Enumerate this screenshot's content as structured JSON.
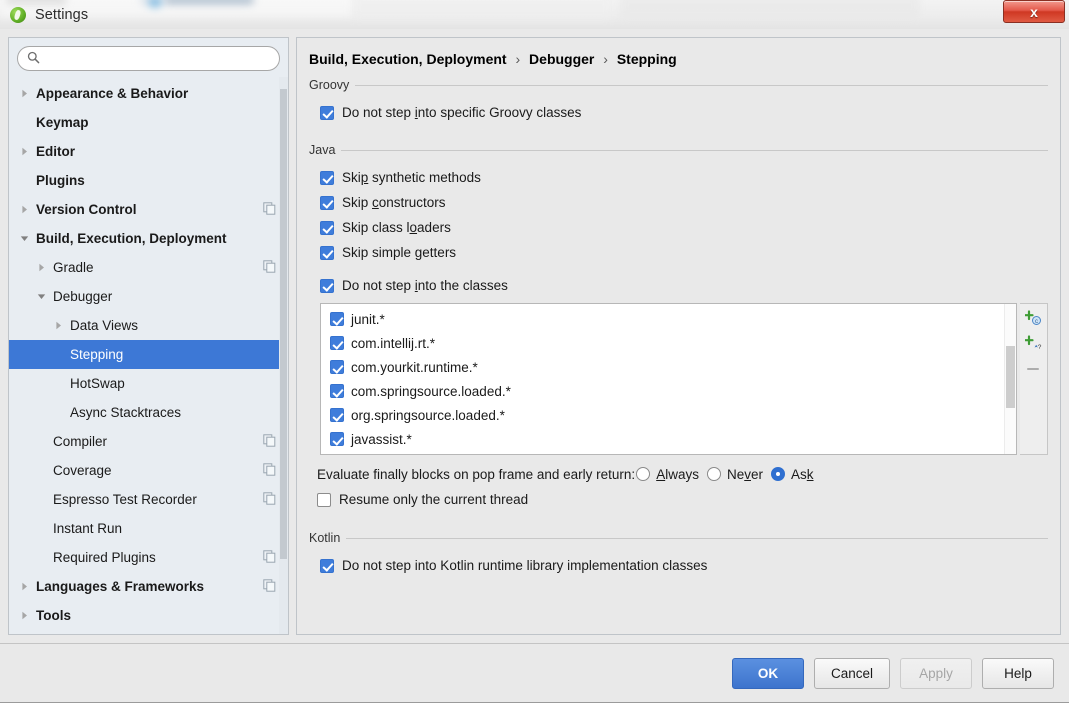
{
  "window": {
    "title": "Settings",
    "app_icon": "intellij-idea-icon",
    "close_label": "x"
  },
  "sidebar": {
    "search": {
      "placeholder": "",
      "value": "",
      "icon": "search-icon"
    },
    "items": [
      {
        "label": "Appearance & Behavior",
        "level": 0,
        "twisty": "collapsed",
        "copy": false,
        "selected": false
      },
      {
        "label": "Keymap",
        "level": 0,
        "twisty": "none",
        "copy": false,
        "selected": false
      },
      {
        "label": "Editor",
        "level": 0,
        "twisty": "collapsed",
        "copy": false,
        "selected": false
      },
      {
        "label": "Plugins",
        "level": 0,
        "twisty": "none",
        "copy": false,
        "selected": false
      },
      {
        "label": "Version Control",
        "level": 0,
        "twisty": "collapsed",
        "copy": true,
        "selected": false
      },
      {
        "label": "Build, Execution, Deployment",
        "level": 0,
        "twisty": "expanded",
        "copy": false,
        "selected": false
      },
      {
        "label": "Gradle",
        "level": 1,
        "twisty": "collapsed",
        "copy": true,
        "selected": false
      },
      {
        "label": "Debugger",
        "level": 1,
        "twisty": "expanded",
        "copy": false,
        "selected": false
      },
      {
        "label": "Data Views",
        "level": 2,
        "twisty": "collapsed",
        "copy": false,
        "selected": false
      },
      {
        "label": "Stepping",
        "level": 2,
        "twisty": "none",
        "copy": false,
        "selected": true
      },
      {
        "label": "HotSwap",
        "level": 2,
        "twisty": "none",
        "copy": false,
        "selected": false
      },
      {
        "label": "Async Stacktraces",
        "level": 2,
        "twisty": "none",
        "copy": false,
        "selected": false
      },
      {
        "label": "Compiler",
        "level": 1,
        "twisty": "none",
        "copy": true,
        "selected": false
      },
      {
        "label": "Coverage",
        "level": 1,
        "twisty": "none",
        "copy": true,
        "selected": false
      },
      {
        "label": "Espresso Test Recorder",
        "level": 1,
        "twisty": "none",
        "copy": true,
        "selected": false
      },
      {
        "label": "Instant Run",
        "level": 1,
        "twisty": "none",
        "copy": false,
        "selected": false
      },
      {
        "label": "Required Plugins",
        "level": 1,
        "twisty": "none",
        "copy": true,
        "selected": false
      },
      {
        "label": "Languages & Frameworks",
        "level": 0,
        "twisty": "collapsed",
        "copy": true,
        "selected": false
      },
      {
        "label": "Tools",
        "level": 0,
        "twisty": "collapsed",
        "copy": false,
        "selected": false
      }
    ]
  },
  "main": {
    "breadcrumb": {
      "part1": "Build, Execution, Deployment",
      "part2": "Debugger",
      "part3": "Stepping",
      "separator": "›"
    },
    "groovy": {
      "section_title": "Groovy",
      "checkbox": {
        "label_before": "Do not step ",
        "mnemonic": "i",
        "label_after": "nto specific Groovy classes",
        "checked": true
      }
    },
    "java": {
      "section_title": "Java",
      "checkboxes": [
        {
          "label_before": "Ski",
          "mnemonic": "p",
          "label_after": " synthetic methods",
          "checked": true
        },
        {
          "label_before": "Skip ",
          "mnemonic": "c",
          "label_after": "onstructors",
          "checked": true
        },
        {
          "label_before": "Skip class l",
          "mnemonic": "o",
          "label_after": "aders",
          "checked": true
        },
        {
          "label_before": "Skip simple ",
          "mnemonic": "g",
          "label_after": "etters",
          "checked": true
        },
        {
          "label_before": "Do not step ",
          "mnemonic": "i",
          "label_after": "nto the classes",
          "checked": true
        }
      ],
      "class_list": [
        {
          "label": "junit.*",
          "checked": true
        },
        {
          "label": "com.intellij.rt.*",
          "checked": true
        },
        {
          "label": "com.yourkit.runtime.*",
          "checked": true
        },
        {
          "label": "com.springsource.loaded.*",
          "checked": true
        },
        {
          "label": "org.springsource.loaded.*",
          "checked": true
        },
        {
          "label": "javassist.*",
          "checked": true
        },
        {
          "label": "",
          "checked": true
        }
      ],
      "list_tools": [
        {
          "name": "add-class-button",
          "icon": "plus-class-icon",
          "enabled": true
        },
        {
          "name": "add-pattern-button",
          "icon": "plus-pattern-icon",
          "enabled": true
        },
        {
          "name": "remove-button",
          "icon": "minus-icon",
          "enabled": false
        }
      ],
      "evaluate_row": {
        "label": "Evaluate finally blocks on pop frame and early return:",
        "options": [
          {
            "label_before": "",
            "mnemonic": "A",
            "label_after": "lways",
            "selected": false
          },
          {
            "label_before": "Ne",
            "mnemonic": "v",
            "label_after": "er",
            "selected": false
          },
          {
            "label_before": "As",
            "mnemonic": "k",
            "label_after": "",
            "selected": true
          }
        ]
      },
      "resume_checkbox": {
        "label_before": "Resume only the current thread",
        "mnemonic": "",
        "label_after": "",
        "checked": false
      }
    },
    "kotlin": {
      "section_title": "Kotlin",
      "checkbox": {
        "label_before": "Do not step into Kotlin runtime library implementation classes",
        "mnemonic": "",
        "label_after": "",
        "checked": true
      }
    }
  },
  "footer": {
    "buttons": [
      {
        "label": "OK",
        "style": "primary",
        "enabled": true
      },
      {
        "label": "Cancel",
        "style": "normal",
        "enabled": true
      },
      {
        "label": "Apply",
        "style": "disabled",
        "enabled": false
      },
      {
        "label": "Help",
        "style": "normal",
        "enabled": true
      }
    ]
  },
  "colors": {
    "selection_blue": "#3d78d6",
    "checkbox_blue": "#3f7ddb",
    "primary_button": "#3d74cd",
    "close_red": "#cf3823",
    "sidebar_bg": "#e8edf2",
    "panel_bg": "#e9e9e9"
  }
}
